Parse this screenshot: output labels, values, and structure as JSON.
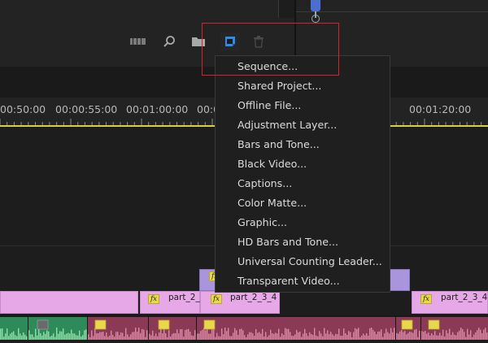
{
  "toolbar": {
    "icons": [
      "list-view-icon",
      "search-icon",
      "bin-icon",
      "new-item-icon",
      "trash-icon"
    ],
    "highlight_color": "#d2262b",
    "accent_color": "#2d8ceb"
  },
  "new_item_menu": {
    "items": [
      "Sequence...",
      "Shared Project...",
      "Offline File...",
      "Adjustment Layer...",
      "Bars and Tone...",
      "Black Video...",
      "Captions...",
      "Color Matte...",
      "Graphic...",
      "HD Bars and Tone...",
      "Universal Counting Leader...",
      "Transparent Video..."
    ]
  },
  "timeline": {
    "timecodes": [
      "00:50:00",
      "00:00:55:00",
      "00:01:00:00",
      "00:0",
      "00:01:20:00"
    ],
    "clips": {
      "v1": [
        "part_2_",
        "part_2_3_4",
        "part_2_3_4"
      ],
      "fx_label": "fx"
    },
    "colors": {
      "work_area": "#d9d13a",
      "video_clip": "#e6a8e6",
      "adjustment_clip": "#a995dc",
      "audio_clip_green": "#2f8a5a",
      "audio_clip_pink": "#8a3a55"
    }
  }
}
